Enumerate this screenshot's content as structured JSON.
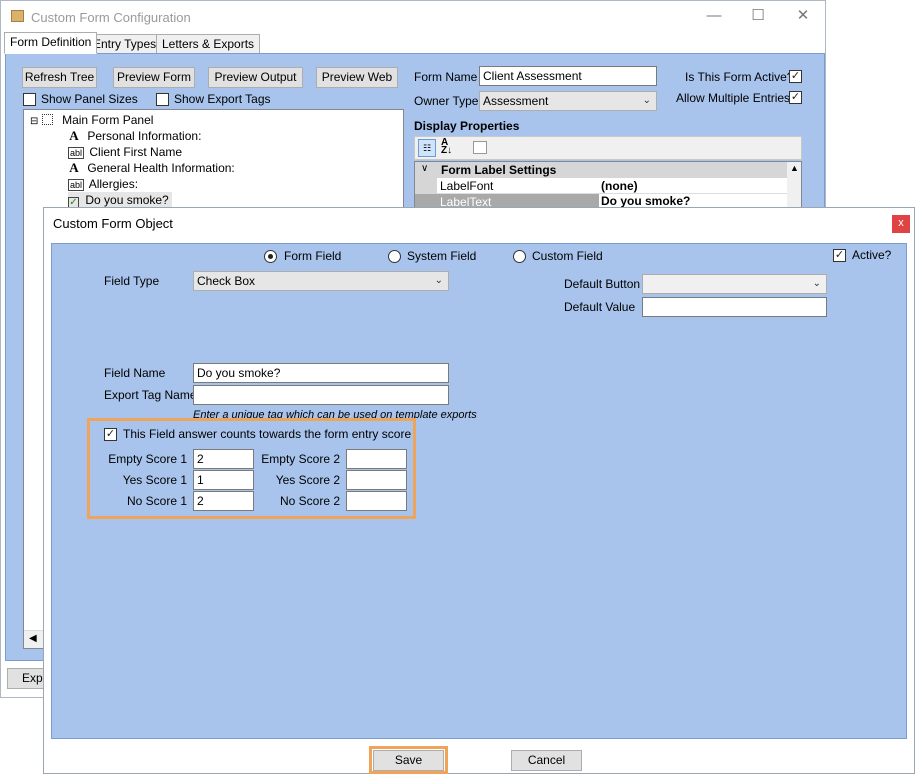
{
  "bg_window": {
    "title": "Custom Form Configuration",
    "tabs": [
      "Form Definition",
      "Entry Types",
      "Letters & Exports"
    ],
    "toolbar": {
      "refresh_tree": "Refresh Tree",
      "preview_form": "Preview Form",
      "preview_output": "Preview Output",
      "preview_web": "Preview Web"
    },
    "show_panel_sizes": "Show Panel Sizes",
    "show_export_tags": "Show Export Tags",
    "tree": [
      {
        "label": "Main Form Panel",
        "icon": "panel-icon"
      },
      {
        "label": "Personal Information:",
        "icon": "text-label-icon"
      },
      {
        "label": "Client First Name",
        "icon": "textbox-icon"
      },
      {
        "label": "General Health Information:",
        "icon": "text-label-icon"
      },
      {
        "label": "Allergies:",
        "icon": "textbox-icon"
      },
      {
        "label": "Do you smoke?",
        "icon": "checkbox-icon"
      }
    ],
    "form_name_label": "Form Name",
    "form_name_value": "Client Assessment",
    "owner_type_label": "Owner Type",
    "owner_type_value": "Assessment",
    "is_active_label": "Is This Form Active?",
    "allow_multiple_label": "Allow Multiple Entries?",
    "display_properties": "Display Properties",
    "prop_section": "Form Label Settings",
    "props": [
      {
        "name": "LabelFont",
        "value": "(none)"
      },
      {
        "name": "LabelText",
        "value": "Do you smoke?"
      }
    ],
    "export_button_partial": "Expo"
  },
  "dialog": {
    "title": "Custom Form Object",
    "close": "x",
    "radio_form_field": "Form Field",
    "radio_system_field": "System Field",
    "radio_custom_field": "Custom Field",
    "active_label": "Active?",
    "field_type_label": "Field Type",
    "field_type_value": "Check Box",
    "default_button_label": "Default Button",
    "default_button_value": "",
    "default_value_label": "Default Value",
    "default_value_value": "",
    "field_name_label": "Field Name",
    "field_name_value": "Do you smoke?",
    "export_tag_label": "Export Tag Name",
    "export_tag_value": "",
    "export_tag_hint": "Enter a unique tag which can be used on template exports",
    "score_checkbox_label": "This Field answer counts towards the form entry score",
    "empty_score_1_label": "Empty Score 1",
    "empty_score_1_value": "2",
    "yes_score_1_label": "Yes Score 1",
    "yes_score_1_value": "1",
    "no_score_1_label": "No Score 1",
    "no_score_1_value": "2",
    "empty_score_2_label": "Empty Score 2",
    "empty_score_2_value": "",
    "yes_score_2_label": "Yes Score 2",
    "yes_score_2_value": "",
    "no_score_2_label": "No Score 2",
    "no_score_2_value": "",
    "save": "Save",
    "cancel": "Cancel"
  },
  "colors": {
    "panel_bg": "#a8c4ec",
    "highlight": "#f0a45a",
    "close_red": "#e04343"
  }
}
